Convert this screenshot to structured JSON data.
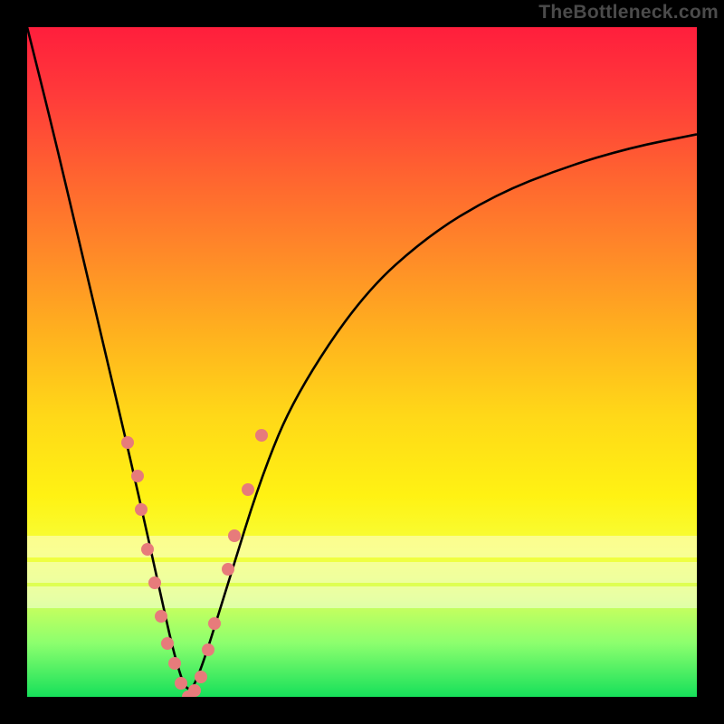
{
  "chart_data": {
    "type": "line",
    "watermark": "TheBottleneck.com",
    "description": "Bottleneck-percentage curve. X axis is relative component balance (0–100). Y axis is bottleneck percent (0 at bottom = perfect, 100 at top = fully bottlenecked). Minimum (optimum) is near x≈24.",
    "x_range": [
      0,
      100
    ],
    "y_range": [
      0,
      100
    ],
    "optimum_x": 24,
    "curve_samples": [
      {
        "x": 0,
        "y": 100
      },
      {
        "x": 4,
        "y": 84
      },
      {
        "x": 8,
        "y": 67
      },
      {
        "x": 12,
        "y": 50
      },
      {
        "x": 16,
        "y": 33
      },
      {
        "x": 20,
        "y": 15
      },
      {
        "x": 22,
        "y": 6
      },
      {
        "x": 24,
        "y": 0
      },
      {
        "x": 26,
        "y": 4
      },
      {
        "x": 30,
        "y": 17
      },
      {
        "x": 35,
        "y": 33
      },
      {
        "x": 40,
        "y": 45
      },
      {
        "x": 50,
        "y": 60
      },
      {
        "x": 60,
        "y": 69
      },
      {
        "x": 70,
        "y": 75
      },
      {
        "x": 80,
        "y": 79
      },
      {
        "x": 90,
        "y": 82
      },
      {
        "x": 100,
        "y": 84
      }
    ],
    "dots": [
      {
        "x": 15,
        "y": 38
      },
      {
        "x": 16.5,
        "y": 33
      },
      {
        "x": 17,
        "y": 28
      },
      {
        "x": 18,
        "y": 22
      },
      {
        "x": 19,
        "y": 17
      },
      {
        "x": 20,
        "y": 12
      },
      {
        "x": 21,
        "y": 8
      },
      {
        "x": 22,
        "y": 5
      },
      {
        "x": 23,
        "y": 2
      },
      {
        "x": 24,
        "y": 0
      },
      {
        "x": 25,
        "y": 1
      },
      {
        "x": 26,
        "y": 3
      },
      {
        "x": 27,
        "y": 7
      },
      {
        "x": 28,
        "y": 11
      },
      {
        "x": 30,
        "y": 19
      },
      {
        "x": 31,
        "y": 24
      },
      {
        "x": 33,
        "y": 31
      },
      {
        "x": 35,
        "y": 39
      }
    ],
    "gradient_stops": [
      {
        "pct": 0,
        "color": "#ff1e3c"
      },
      {
        "pct": 50,
        "color": "#ffd818"
      },
      {
        "pct": 80,
        "color": "#f6ff3a"
      },
      {
        "pct": 100,
        "color": "#16e05a"
      }
    ]
  }
}
